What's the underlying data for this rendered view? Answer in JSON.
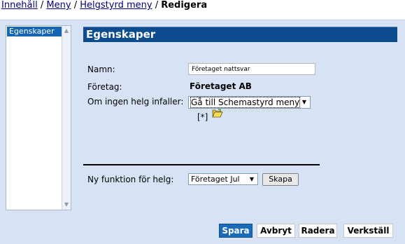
{
  "breadcrumb": {
    "items": [
      "Innehåll",
      "Meny",
      "Helgstyrd meny"
    ],
    "separator": "/",
    "current": "Redigera"
  },
  "tree": {
    "items": [
      "Egenskaper"
    ]
  },
  "header": {
    "title": "Egenskaper"
  },
  "form": {
    "name_label": "Namn:",
    "name_value": "Företaget nattsvar",
    "company_label": "Företag:",
    "company_value": "Företaget AB",
    "no_holiday_label": "Om ingen helg infaller:",
    "no_holiday_selected": "Gå till Schemastyrd meny",
    "star_link": "[*]",
    "new_function_label": "Ny funktion för helg:",
    "new_function_selected": "Företaget Jul",
    "create_label": "Skapa"
  },
  "actions": {
    "save": "Spara",
    "cancel": "Avbryt",
    "delete": "Radera",
    "apply": "Verkställ"
  },
  "colors": {
    "panel_bg": "#d7e3f5",
    "header_bg": "#0d4c8f",
    "primary_button": "#1c6bb9",
    "tree_selected": "#1466b2"
  },
  "icons": [
    "dropdown-arrow-icon",
    "folder-open-icon",
    "scroll-up-icon",
    "scroll-down-icon"
  ]
}
